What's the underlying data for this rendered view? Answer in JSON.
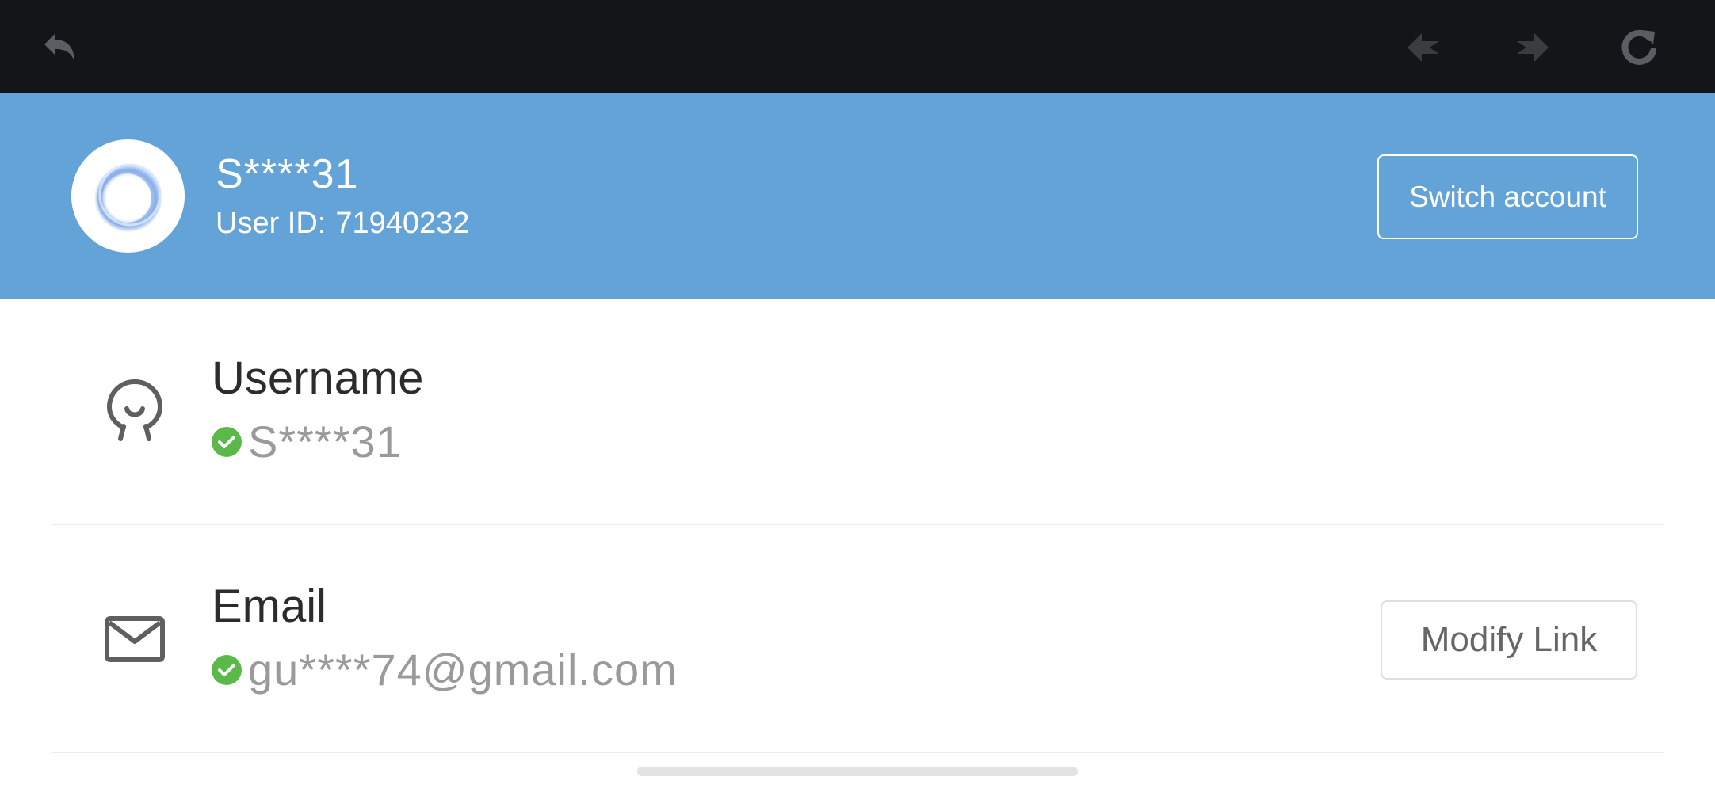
{
  "toolbar": {
    "icons": [
      "back-icon",
      "previous-icon",
      "next-icon",
      "reload-icon"
    ],
    "background": "#141518"
  },
  "account": {
    "display_name": "S****31",
    "user_id_label": "User ID:",
    "user_id": "71940232",
    "switch_label": "Switch account",
    "header_color": "#64a3d8"
  },
  "rows": {
    "username": {
      "title": "Username",
      "value": "S****31",
      "icon": "user-icon",
      "verified": true
    },
    "email": {
      "title": "Email",
      "value": "gu****74@gmail.com",
      "icon": "envelope-icon",
      "verified": true,
      "action_label": "Modify Link"
    }
  },
  "colors": {
    "verified": "#5bb94a",
    "muted_text": "#9a9a9a"
  }
}
